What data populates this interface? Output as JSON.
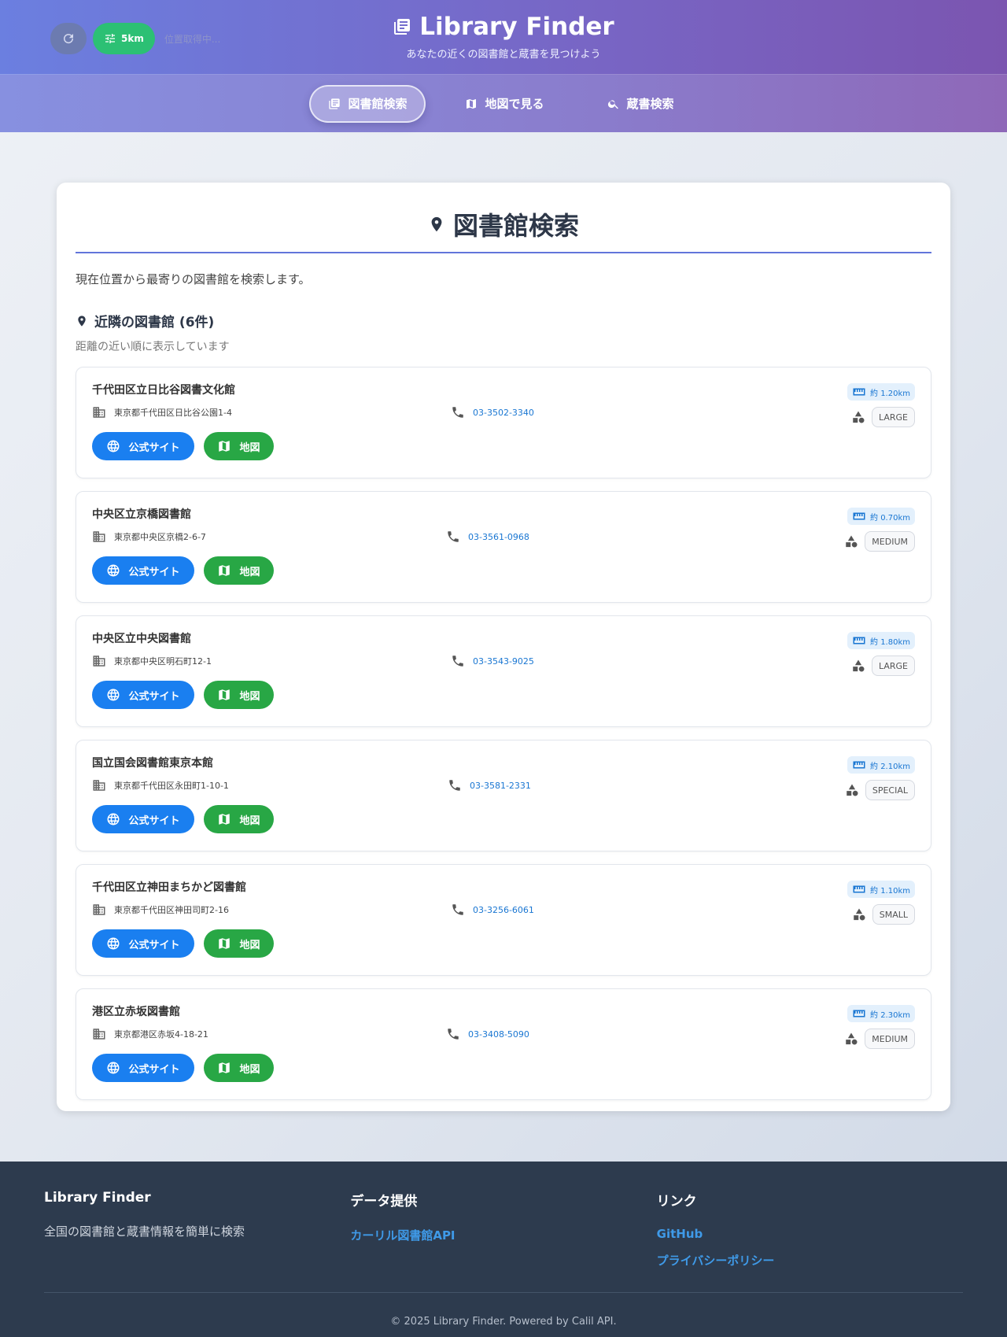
{
  "header": {
    "title": "Library Finder",
    "subtitle": "あなたの近くの図書館と蔵書を見つけよう",
    "radius_label": "5km",
    "location_status": "位置取得中..."
  },
  "nav": {
    "tabs": [
      {
        "label": "図書館検索",
        "active": true,
        "icon": "book-icon"
      },
      {
        "label": "地図で見る",
        "active": false,
        "icon": "map-icon"
      },
      {
        "label": "蔵書検索",
        "active": false,
        "icon": "search-icon"
      }
    ]
  },
  "main": {
    "title": "図書館検索",
    "description": "現在位置から最寄りの図書館を検索します。",
    "nearby_heading": "近隣の図書館 (6件)",
    "nearby_subtext": "距離の近い順に表示しています",
    "site_button_label": "公式サイト",
    "map_button_label": "地図",
    "libraries": [
      {
        "name": "千代田区立日比谷図書文化館",
        "address": "東京都千代田区日比谷公園1-4",
        "tel": "03-3502-3340",
        "distance": "約 1.20km",
        "category": "LARGE"
      },
      {
        "name": "中央区立京橋図書館",
        "address": "東京都中央区京橋2-6-7",
        "tel": "03-3561-0968",
        "distance": "約 0.70km",
        "category": "MEDIUM"
      },
      {
        "name": "中央区立中央図書館",
        "address": "東京都中央区明石町12-1",
        "tel": "03-3543-9025",
        "distance": "約 1.80km",
        "category": "LARGE"
      },
      {
        "name": "国立国会図書館東京本館",
        "address": "東京都千代田区永田町1-10-1",
        "tel": "03-3581-2331",
        "distance": "約 2.10km",
        "category": "SPECIAL"
      },
      {
        "name": "千代田区立神田まちかど図書館",
        "address": "東京都千代田区神田司町2-16",
        "tel": "03-3256-6061",
        "distance": "約 1.10km",
        "category": "SMALL"
      },
      {
        "name": "港区立赤坂図書館",
        "address": "東京都港区赤坂4-18-21",
        "tel": "03-3408-5090",
        "distance": "約 2.30km",
        "category": "MEDIUM"
      }
    ]
  },
  "footer": {
    "col1": {
      "title": "Library Finder",
      "text": "全国の図書館と蔵書情報を簡単に検索"
    },
    "col2": {
      "title": "データ提供",
      "links": [
        "カーリル図書館API"
      ]
    },
    "col3": {
      "title": "リンク",
      "links": [
        "GitHub",
        "プライバシーポリシー"
      ]
    },
    "copyright": "© 2025 Library Finder. Powered by Calil API."
  },
  "colors": {
    "header_gradient_start": "#6b7fe0",
    "header_gradient_end": "#7b55b0",
    "site_button": "#1a7ff0",
    "map_button": "#28a745",
    "radius_button": "#2cc074",
    "footer_bg": "#2d3b4e",
    "link": "#3f9ae8"
  }
}
